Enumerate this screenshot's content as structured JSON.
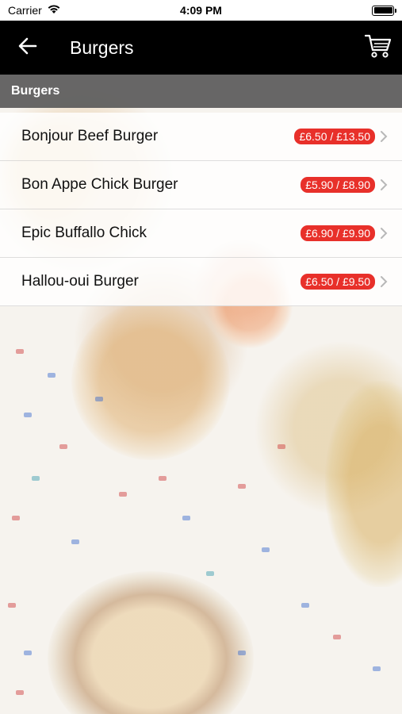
{
  "status_bar": {
    "carrier": "Carrier",
    "time": "4:09 PM"
  },
  "nav": {
    "title": "Burgers",
    "back_icon": "arrow-left-icon",
    "cart_icon": "cart-icon"
  },
  "section": {
    "title": "Burgers"
  },
  "items": [
    {
      "name": "Bonjour Beef Burger",
      "price": "£6.50 / £13.50"
    },
    {
      "name": "Bon Appe Chick Burger",
      "price": "£5.90 / £8.90"
    },
    {
      "name": "Epic Buffallo Chick",
      "price": "£6.90 / £9.90"
    },
    {
      "name": "Hallou-oui Burger",
      "price": "£6.50 / £9.50"
    }
  ],
  "colors": {
    "nav_bg": "#000000",
    "section_bg": "#5a5a5a",
    "price_badge": "#e8302a"
  }
}
